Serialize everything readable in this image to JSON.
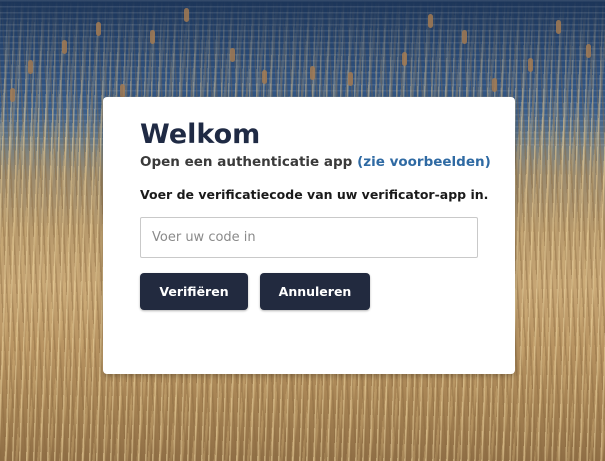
{
  "background": {
    "description_icon": "lake-reeds-photo"
  },
  "dialog": {
    "title": "Welkom",
    "subtitle_text": "Open een authenticatie app ",
    "subtitle_link": "(zie voorbeelden)",
    "instruction": "Voer de verificatiecode van uw verificator-app in.",
    "code_input": {
      "value": "",
      "placeholder": "Voer uw code in"
    },
    "buttons": {
      "verify_label": "Verifiëren",
      "cancel_label": "Annuleren"
    }
  },
  "colors": {
    "button_bg": "#222a3f",
    "link": "#2f6aa3",
    "title": "#1f2a44"
  }
}
